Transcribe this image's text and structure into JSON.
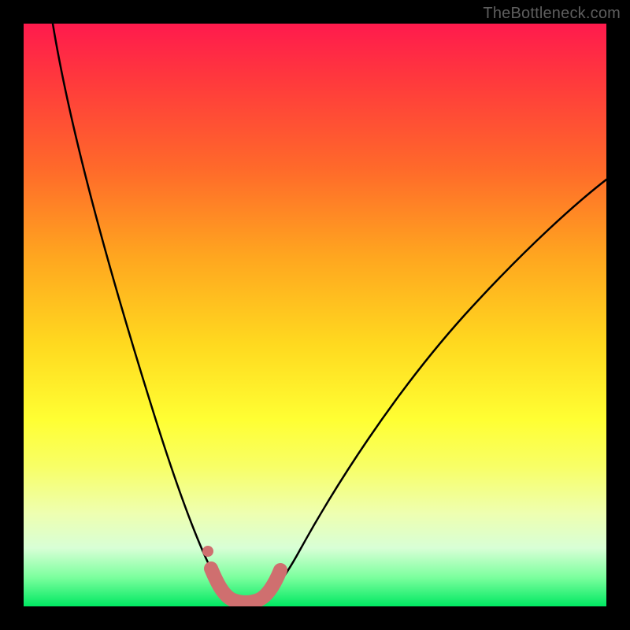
{
  "watermark": {
    "text": "TheBottleneck.com"
  },
  "chart_data": {
    "type": "line",
    "title": "",
    "xlabel": "",
    "ylabel": "",
    "xlim": [
      0,
      100
    ],
    "ylim": [
      0,
      100
    ],
    "series": [
      {
        "name": "bottleneck-curve",
        "x": [
          5,
          10,
          15,
          20,
          25,
          30,
          32,
          34,
          35,
          36,
          37,
          38,
          39,
          40,
          41,
          42,
          45,
          50,
          55,
          60,
          65,
          70,
          75,
          80,
          85,
          90,
          95,
          100
        ],
        "values": [
          100,
          85,
          69,
          53,
          36,
          18,
          10,
          4,
          2,
          1,
          0.5,
          0.5,
          0.5,
          1,
          2,
          4,
          10,
          20,
          29,
          37,
          44,
          50,
          55,
          60,
          64,
          67,
          70,
          72
        ]
      }
    ],
    "highlight": {
      "name": "optimal-range",
      "color": "#cf6f6f",
      "x": [
        32.5,
        33.5,
        34.5,
        35.5,
        36.5,
        37.5,
        38.5,
        39.5,
        40.5,
        41.5,
        42.5
      ],
      "values": [
        8,
        5,
        3,
        1.5,
        0.7,
        0.5,
        0.5,
        0.7,
        1.5,
        3,
        5
      ]
    },
    "highlight_point": {
      "x": 32,
      "value": 10,
      "color": "#cf6f6f"
    },
    "background": {
      "type": "vertical-gradient",
      "stops": [
        {
          "pos": 0,
          "color": "#ff1a4d"
        },
        {
          "pos": 25,
          "color": "#ff6a2a"
        },
        {
          "pos": 55,
          "color": "#ffd91f"
        },
        {
          "pos": 76,
          "color": "#f8ff66"
        },
        {
          "pos": 90,
          "color": "#d8ffd6"
        },
        {
          "pos": 100,
          "color": "#00e862"
        }
      ]
    }
  }
}
